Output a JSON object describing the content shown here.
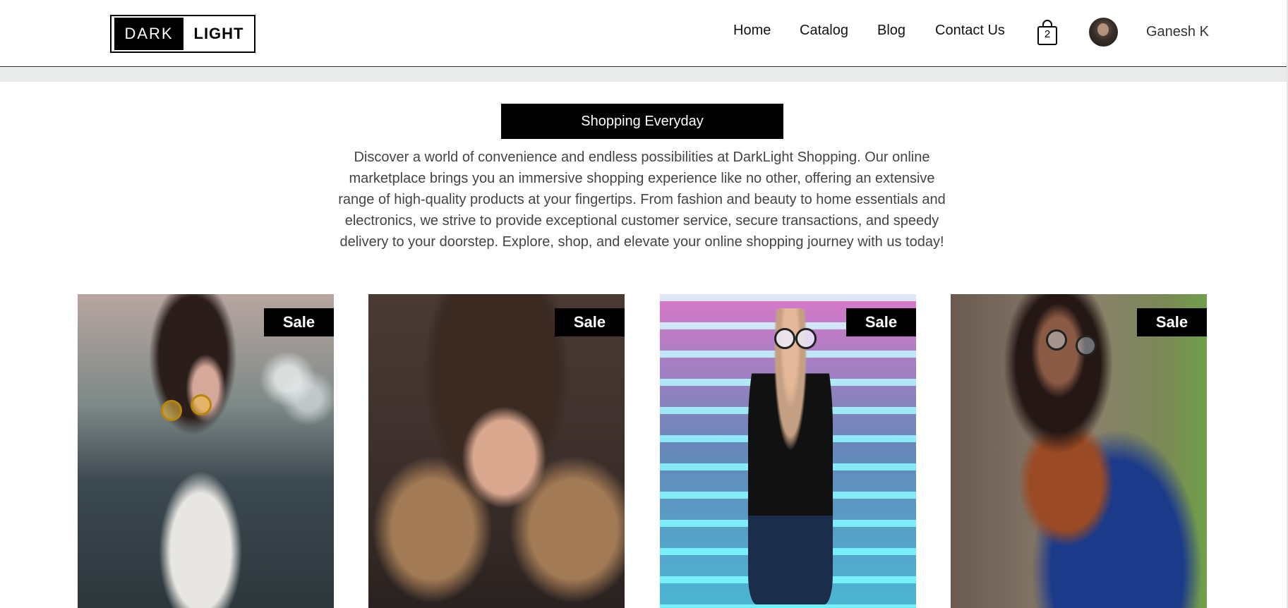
{
  "logo": {
    "dark": "DARK",
    "light": "LIGHT"
  },
  "nav": {
    "items": [
      "Home",
      "Catalog",
      "Blog",
      "Contact Us"
    ],
    "cart_count": "2",
    "user_name": "Ganesh K"
  },
  "hero": {
    "banner": "Shopping Everyday",
    "description": "Discover a world of convenience and endless possibilities at DarkLight Shopping. Our online marketplace brings you an immersive shopping experience like no other, offering an extensive range of high-quality products at your fingertips. From fashion and beauty to home essentials and electronics, we strive to provide exceptional customer service, secure transactions, and speedy delivery to your doorstep. Explore, shop, and elevate your online shopping journey with us today!"
  },
  "products": [
    {
      "badge": "Sale"
    },
    {
      "badge": "Sale"
    },
    {
      "badge": "Sale"
    },
    {
      "badge": "Sale"
    }
  ],
  "colors": {
    "accent": "#000000",
    "band": "#e9eaea"
  }
}
